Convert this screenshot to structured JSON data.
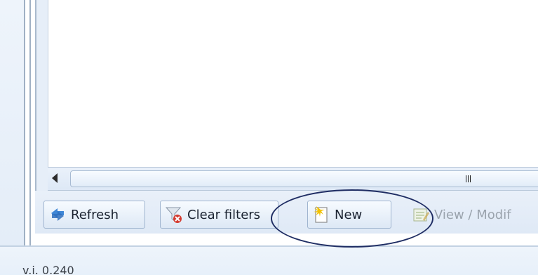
{
  "toolbar": {
    "refresh_label": "Refresh",
    "clear_filters_label": "Clear filters",
    "new_label": "New",
    "view_modify_label": "View / Modif"
  },
  "scrollbar": {
    "grip_icon": "grip-lines-icon"
  },
  "status": {
    "text": "v.i. 0.240"
  },
  "icons": {
    "refresh": "refresh-arrows-icon",
    "clear_filters": "funnel-remove-icon",
    "new": "new-document-icon",
    "view_modify": "edit-document-icon"
  },
  "colors": {
    "annotation": "#1f2d63",
    "accent": "#3f86d6"
  }
}
